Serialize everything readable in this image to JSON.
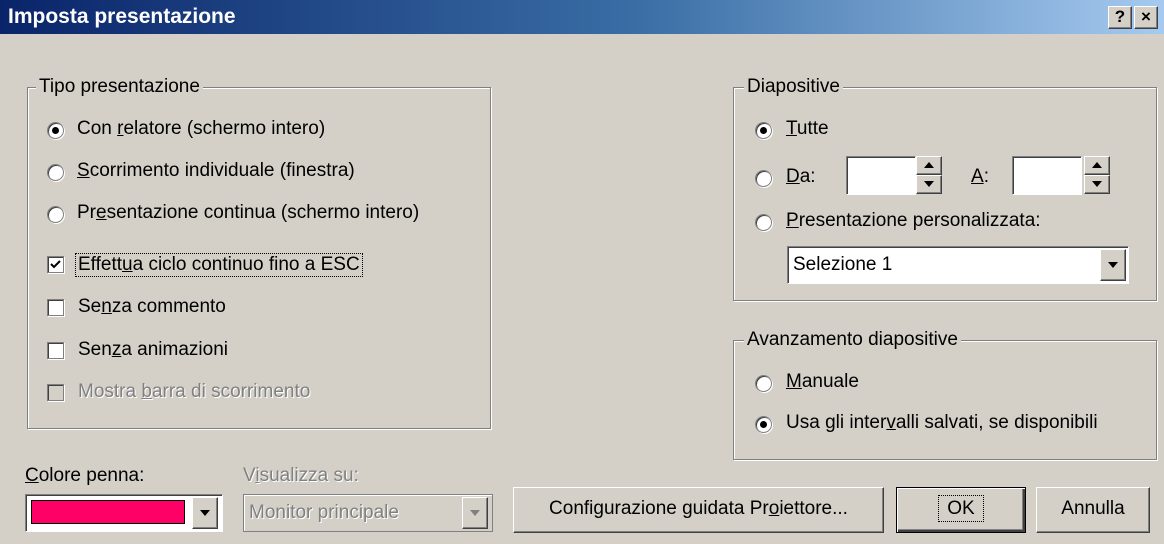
{
  "window": {
    "title": "Imposta presentazione",
    "help_glyph": "?",
    "close_glyph": "×"
  },
  "tipo": {
    "legend": "Tipo presentazione",
    "radios": [
      {
        "pre": "Con ",
        "key": "r",
        "post": "elatore (schermo intero)",
        "selected": true
      },
      {
        "pre": "",
        "key": "S",
        "post": "corrimento individuale (finestra)",
        "selected": false
      },
      {
        "pre": "Pr",
        "key": "e",
        "post": "sentazione continua (schermo intero)",
        "selected": false
      }
    ],
    "checks": [
      {
        "pre": "Effett",
        "key": "u",
        "post": "a ciclo continuo fino a ESC",
        "checked": true,
        "disabled": false
      },
      {
        "pre": "Se",
        "key": "n",
        "post": "za commento",
        "checked": false,
        "disabled": false
      },
      {
        "pre": "Sen",
        "key": "z",
        "post": "a animazioni",
        "checked": false,
        "disabled": false
      },
      {
        "pre": "Mostra ",
        "key": "b",
        "post": "arra di scorrimento",
        "checked": false,
        "disabled": true
      }
    ]
  },
  "diapositive": {
    "legend": "Diapositive",
    "tutte": {
      "pre": "",
      "key": "T",
      "post": "utte",
      "selected": true
    },
    "da": {
      "pre": "",
      "key": "D",
      "post": "a:",
      "selected": false,
      "value": ""
    },
    "a": {
      "pre": "",
      "key": "A",
      "post": ":",
      "value": ""
    },
    "personalizzata": {
      "pre": "",
      "key": "P",
      "post": "resentazione personalizzata:",
      "selected": false
    },
    "select_value": "Selezione 1"
  },
  "avanzamento": {
    "legend": "Avanzamento diapositive",
    "manuale": {
      "pre": "",
      "key": "M",
      "post": "anuale",
      "selected": false
    },
    "intervalli": {
      "pre": "Usa gli inter",
      "key": "v",
      "post": "alli salvati, se disponibili",
      "selected": true
    }
  },
  "footer": {
    "colore_label": {
      "pre": "",
      "key": "C",
      "post": "olore penna:"
    },
    "pen_color": "#ff0066",
    "visualizza_label": {
      "pre": "V",
      "key": "i",
      "post": "sualizza su:"
    },
    "monitor_value": "Monitor principale",
    "proiettore_button": {
      "pre": "Configurazione guidata Pr",
      "key": "o",
      "post": "iettore..."
    },
    "ok_button": "OK",
    "annulla_button": "Annulla"
  }
}
